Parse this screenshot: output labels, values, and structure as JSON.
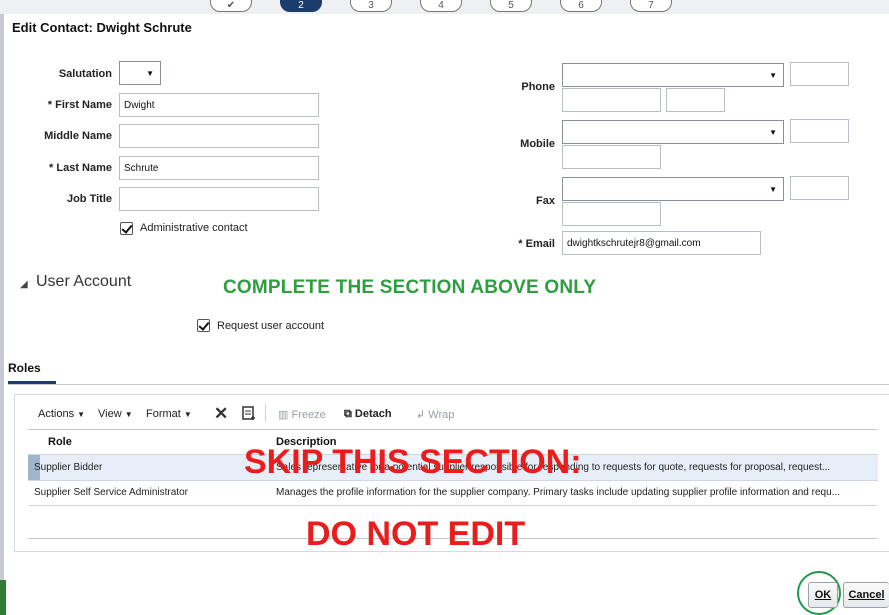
{
  "stepper": {
    "steps": [
      "",
      "2",
      "3",
      "4",
      "5",
      "6",
      "7"
    ],
    "active_index": 1
  },
  "dialog": {
    "title": "Edit Contact: Dwight Schrute"
  },
  "form": {
    "salutation": {
      "label": "Salutation",
      "value": ""
    },
    "first_name": {
      "label": "First Name",
      "required_mark": "*",
      "value": "Dwight"
    },
    "middle_name": {
      "label": "Middle Name",
      "value": ""
    },
    "last_name": {
      "label": "Last Name",
      "required_mark": "*",
      "value": "Schrute"
    },
    "job_title": {
      "label": "Job Title",
      "value": ""
    },
    "admin_contact": {
      "label": "Administrative contact",
      "checked": true
    },
    "phone": {
      "label": "Phone"
    },
    "mobile": {
      "label": "Mobile"
    },
    "fax": {
      "label": "Fax"
    },
    "email": {
      "label": "Email",
      "required_mark": "*",
      "value": "dwightkschrutejr8@gmail.com"
    }
  },
  "user_account": {
    "title": "User Account",
    "request_label": "Request user account",
    "request_checked": true
  },
  "annotations": {
    "complete_above": "COMPLETE THE SECTION ABOVE ONLY",
    "skip": "SKIP THIS SECTION:",
    "do_not_edit": "DO NOT EDIT",
    "green": "#2e9e3e",
    "red": "#ea1c1c"
  },
  "roles": {
    "tab_label": "Roles",
    "toolbar": {
      "actions": "Actions",
      "view": "View",
      "format": "Format",
      "freeze": "Freeze",
      "detach": "Detach",
      "wrap": "Wrap"
    },
    "columns": [
      "Role",
      "Description"
    ],
    "rows": [
      {
        "role": "Supplier Bidder",
        "description": "Sales representative for a potential supplier responsible for responding to requests for quote, requests for proposal, request..."
      },
      {
        "role": "Supplier Self Service Administrator",
        "description": "Manages the profile information for the supplier company. Primary tasks include updating supplier profile information and requ..."
      }
    ]
  },
  "buttons": {
    "ok": "OK",
    "cancel": "Cancel"
  },
  "colors": {
    "accent": "#1a3d6e",
    "focus_ring": "#1f9a4b"
  }
}
